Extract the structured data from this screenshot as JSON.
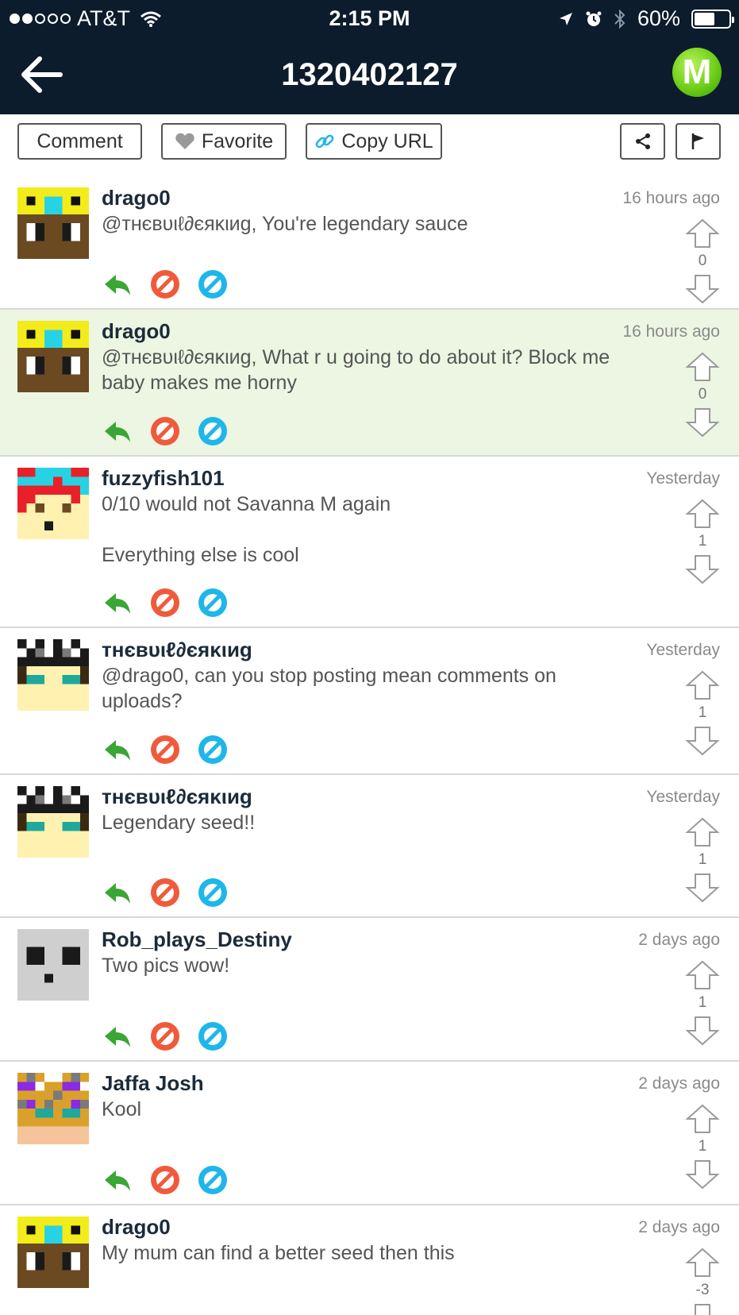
{
  "status_bar": {
    "carrier": "AT&T",
    "time": "2:15 PM",
    "battery": "60%",
    "battery_level": 0.6
  },
  "nav": {
    "title": "1320402127",
    "logo_letter": "M"
  },
  "toolbar": {
    "comment_label": "Comment",
    "favorite_label": "Favorite",
    "copy_url_label": "Copy URL"
  },
  "comments": [
    {
      "user": "drago0",
      "time": "16 hours ago",
      "lines": [
        "@ᴛʜєвυιℓ∂єяκιиg, You're legendary sauce"
      ],
      "votes": "0",
      "highlighted": false,
      "avatar": "drago"
    },
    {
      "user": "drago0",
      "time": "16 hours ago",
      "lines": [
        "@ᴛʜєвυιℓ∂єяκιиg, What r u going to do about it? Block me",
        "baby makes me horny"
      ],
      "votes": "0",
      "highlighted": true,
      "avatar": "drago"
    },
    {
      "user": "fuzzyfish101",
      "time": "Yesterday",
      "lines": [
        "0/10 would not Savanna M again",
        "",
        "Everything else is cool"
      ],
      "votes": "1",
      "highlighted": false,
      "avatar": "fuzzy"
    },
    {
      "user": "ᴛʜєвυιℓ∂єяκιиg",
      "time": "Yesterday",
      "lines": [
        "@drago0, can you stop posting mean comments on",
        "uploads?"
      ],
      "votes": "1",
      "highlighted": false,
      "avatar": "builder"
    },
    {
      "user": "ᴛʜєвυιℓ∂єяκιиg",
      "time": "Yesterday",
      "lines": [
        "Legendary seed!!"
      ],
      "votes": "1",
      "highlighted": false,
      "avatar": "builder"
    },
    {
      "user": "Rob_plays_Destiny",
      "time": "2 days ago",
      "lines": [
        "Two pics wow!"
      ],
      "votes": "1",
      "highlighted": false,
      "avatar": "ghost"
    },
    {
      "user": "Jaffa Josh",
      "time": "2 days ago",
      "lines": [
        "Kool"
      ],
      "votes": "1",
      "highlighted": false,
      "avatar": "jaffa"
    },
    {
      "user": "drago0",
      "time": "2 days ago",
      "lines": [
        "My mum can find a better seed then this"
      ],
      "votes": "-3",
      "highlighted": false,
      "avatar": "drago"
    }
  ],
  "colors": {
    "header_bg": "#0c1c2c",
    "reply_green": "#3aa635",
    "block_red": "#f05a3c",
    "ignore_blue": "#1fb6ea",
    "highlight_bg": "#ecf6e2"
  }
}
